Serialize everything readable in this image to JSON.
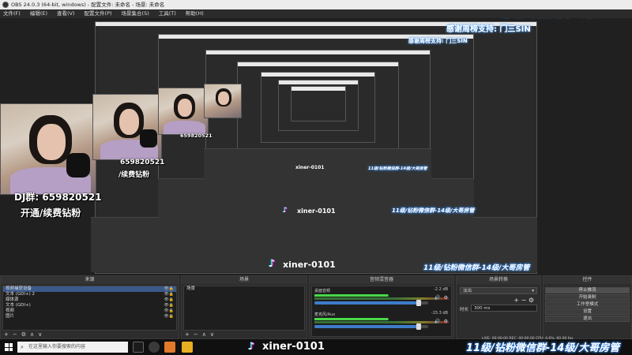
{
  "window": {
    "title": "OBS 24.0.3 (64-bit, windows) - 配置文件: 未命名 - 场景: 未命名"
  },
  "menu": [
    "文件(F)",
    "编辑(E)",
    "查看(V)",
    "配置文件(P)",
    "场景集合(S)",
    "工具(T)",
    "帮助(H)"
  ],
  "overlay": {
    "thanks_banner": "感谢周榜支持: 门三SIN",
    "dj_group": "DJ群: 659820521",
    "open_renew": "开通/续费钻粉",
    "group_number": "659820521",
    "renew_short": "/续费钻粉",
    "tiktok_user": "xiner-0101",
    "scroll_banner": "11级/钻粉微信群-14级/大哥房管"
  },
  "docks": {
    "sources": {
      "title": "来源",
      "items": [
        "视频捕获设备",
        "文本 (GDI+) 2",
        "媒体源",
        "文本 (GDI+)",
        "视频",
        "图片"
      ],
      "footer": [
        "+",
        "−",
        "⚙",
        "∧",
        "∨"
      ]
    },
    "scenes": {
      "title": "场景",
      "items": [
        "场景"
      ],
      "footer": [
        "+",
        "−",
        "∧",
        "∨"
      ]
    },
    "mixer": {
      "title": "音频混音器",
      "channels": [
        {
          "label": "桌面音频",
          "db": "-2.2 dB",
          "level": 0.92
        },
        {
          "label": "麦克风/Aux",
          "db": "-15.3 dB",
          "level": 0.92
        }
      ]
    },
    "transitions": {
      "title": "场景转换",
      "selected": "淡出",
      "duration_label": "时长",
      "duration_value": "300 ms"
    },
    "controls": {
      "title": "控件",
      "buttons": [
        "停止推流",
        "开始录制",
        "工作室模式",
        "设置",
        "退出"
      ]
    }
  },
  "status": {
    "text": "LIVE: 00:00:00  REC: 00:00:00  CPU: 4.6%, 60.00 fps"
  },
  "taskbar": {
    "search_placeholder": "在这里输入你要搜索的内容"
  },
  "colors": {
    "accent": "#3d7dca",
    "selection": "#3b5a8a",
    "banner_glow": "#2f8cff"
  }
}
